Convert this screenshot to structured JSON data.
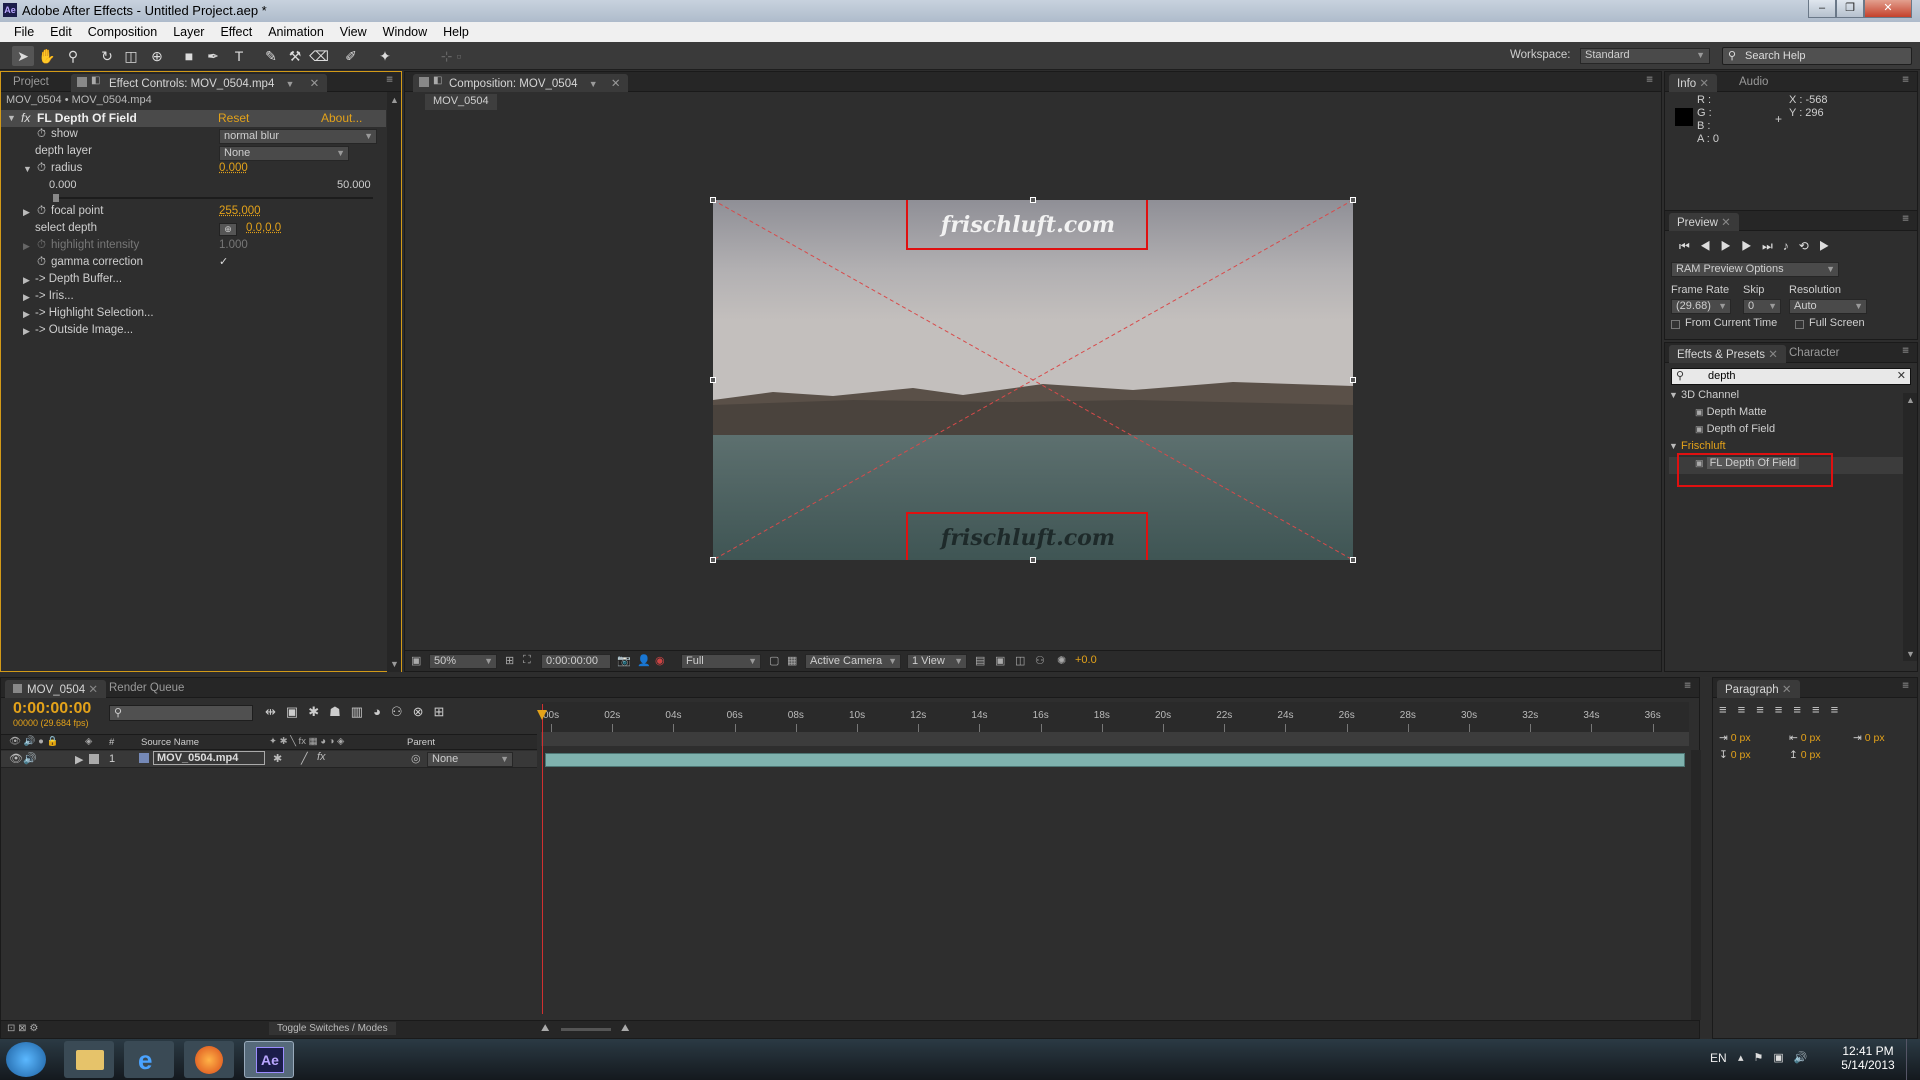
{
  "window": {
    "title": "Adobe After Effects - Untitled Project.aep *",
    "app_icon": "Ae"
  },
  "menu": [
    "File",
    "Edit",
    "Composition",
    "Layer",
    "Effect",
    "Animation",
    "View",
    "Window",
    "Help"
  ],
  "toolbar": {
    "workspace_label": "Workspace:",
    "workspace_value": "Standard",
    "search_placeholder": "Search Help"
  },
  "left_panel": {
    "tabs": [
      "Project",
      "Effect Controls: MOV_0504.mp4"
    ],
    "breadcrumb": "MOV_0504 • MOV_0504.mp4",
    "effect_name": "FL Depth Of Field",
    "reset": "Reset",
    "about": "About...",
    "props": {
      "show_label": "show",
      "show_value": "normal blur",
      "depth_layer_label": "depth layer",
      "depth_layer_value": "None",
      "radius_label": "radius",
      "radius_value": "0.000",
      "radius_min": "0.000",
      "radius_max": "50.000",
      "focal_label": "focal point",
      "focal_value": "255.000",
      "select_depth_label": "select depth",
      "select_depth_value": "0.0,0.0",
      "highlight_label": "highlight intensity",
      "highlight_value": "1.000",
      "gamma_label": "gamma correction",
      "gamma_checked": "✓"
    },
    "groups": [
      "-> Depth Buffer...",
      "-> Iris...",
      "-> Highlight Selection...",
      "-> Outside Image..."
    ]
  },
  "composition": {
    "tab": "Composition: MOV_0504",
    "subtab": "MOV_0504",
    "watermark": "frischluft.com",
    "footer": {
      "zoom": "50%",
      "timecode": "0:00:00:00",
      "resolution": "Full",
      "camera": "Active Camera",
      "view": "1 View",
      "exposure": "+0.0"
    }
  },
  "info": {
    "tabs": [
      "Info",
      "Audio"
    ],
    "r": "R :",
    "g": "G :",
    "b": "B :",
    "a": "A : 0",
    "x": "X : -568",
    "y": "Y : 296"
  },
  "preview": {
    "tab": "Preview",
    "ram_options": "RAM Preview Options",
    "frame_rate_label": "Frame Rate",
    "frame_rate_value": "(29.68)",
    "skip_label": "Skip",
    "skip_value": "0",
    "resolution_label": "Resolution",
    "resolution_value": "Auto",
    "from_current": "From Current Time",
    "full_screen": "Full Screen"
  },
  "effects_presets": {
    "tabs": [
      "Effects & Presets",
      "Character"
    ],
    "search_value": "depth",
    "tree": [
      {
        "label": "3D Channel",
        "children": [
          "Depth Matte",
          "Depth of Field"
        ]
      },
      {
        "label": "Frischluft",
        "children": [
          "FL Depth Of Field"
        ]
      }
    ]
  },
  "timeline": {
    "tabs": [
      "MOV_0504",
      "Render Queue"
    ],
    "timecode": "0:00:00:00",
    "fps_note": "00000 (29.684 fps)",
    "columns": {
      "num": "#",
      "source": "Source Name",
      "parent": "Parent"
    },
    "layer": {
      "num": "1",
      "name": "MOV_0504.mp4",
      "parent": "None"
    },
    "ruler": [
      "00s",
      "02s",
      "04s",
      "06s",
      "08s",
      "10s",
      "12s",
      "14s",
      "16s",
      "18s",
      "20s",
      "22s",
      "24s",
      "26s",
      "28s",
      "30s",
      "32s",
      "34s",
      "36s"
    ],
    "toggle": "Toggle Switches / Modes"
  },
  "paragraph": {
    "tab": "Paragraph",
    "px": "0 px"
  },
  "taskbar": {
    "lang": "EN",
    "time": "12:41 PM",
    "date": "5/14/2013"
  }
}
